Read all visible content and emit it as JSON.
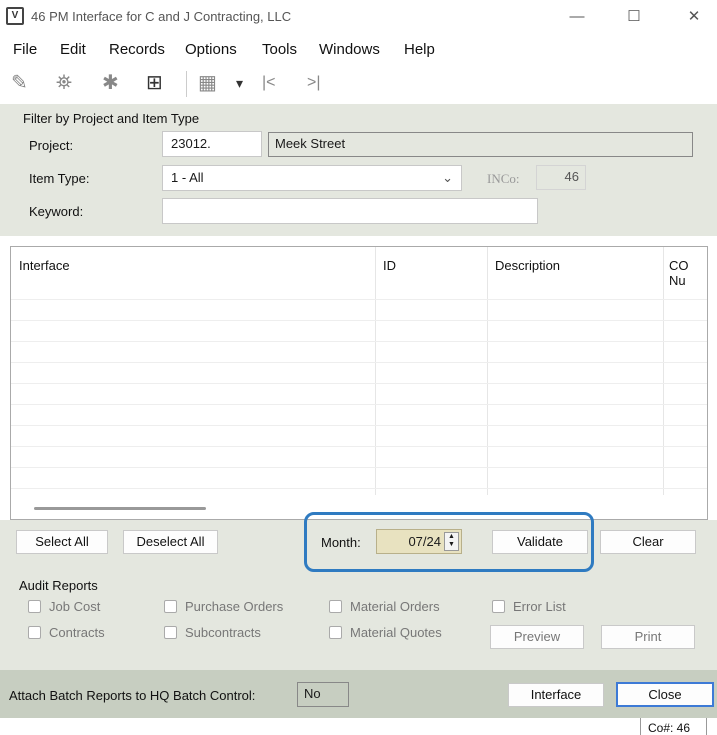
{
  "window": {
    "title": "46 PM Interface for C and J Contracting, LLC",
    "app_icon_text": "V",
    "minimize": "—",
    "maximize": "☐",
    "close": "✕"
  },
  "menu": [
    "File",
    "Edit",
    "Records",
    "Options",
    "Tools",
    "Windows",
    "Help"
  ],
  "toolbar": {
    "icons": [
      "edit-icon",
      "binoculars-icon",
      "settings-icon",
      "calculator-icon",
      "grid-settings-icon",
      "dropdown-arrow-icon",
      "first-record-icon",
      "last-record-icon"
    ],
    "glyphs": [
      "✎",
      "⛯",
      "✱",
      "⊞",
      "▦",
      "▾",
      "|<",
      ">|"
    ]
  },
  "filter": {
    "group_title": "Filter by Project and Item Type",
    "project_label": "Project:",
    "project_value": "23012.",
    "project_name": "Meek Street",
    "item_type_label": "Item Type:",
    "item_type_value": "1 - All",
    "inco_label": "INCo:",
    "inco_value": "46",
    "keyword_label": "Keyword:",
    "keyword_value": ""
  },
  "grid": {
    "columns": [
      "Interface",
      "ID",
      "Description",
      "CO Nu"
    ],
    "rows": []
  },
  "actions": {
    "select_all": "Select All",
    "deselect_all": "Deselect All",
    "month_label": "Month:",
    "month_value": "07/24",
    "validate": "Validate",
    "clear": "Clear"
  },
  "audit": {
    "title": "Audit Reports",
    "checkboxes": {
      "job_cost": "Job Cost",
      "purchase_orders": "Purchase Orders",
      "material_orders": "Material Orders",
      "error_list": "Error List",
      "contracts": "Contracts",
      "subcontracts": "Subcontracts",
      "material_quotes": "Material Quotes"
    },
    "preview": "Preview",
    "print": "Print"
  },
  "attach": {
    "label": "Attach Batch Reports to HQ Batch Control:",
    "value": "No",
    "interface": "Interface",
    "close": "Close"
  },
  "status": {
    "company": "Co#: 46"
  },
  "colors": {
    "panel": "#e4e7df",
    "attach_bar": "#c7cec1",
    "highlight": "#2f7bc1",
    "close_button_border": "#3d7ad6"
  }
}
